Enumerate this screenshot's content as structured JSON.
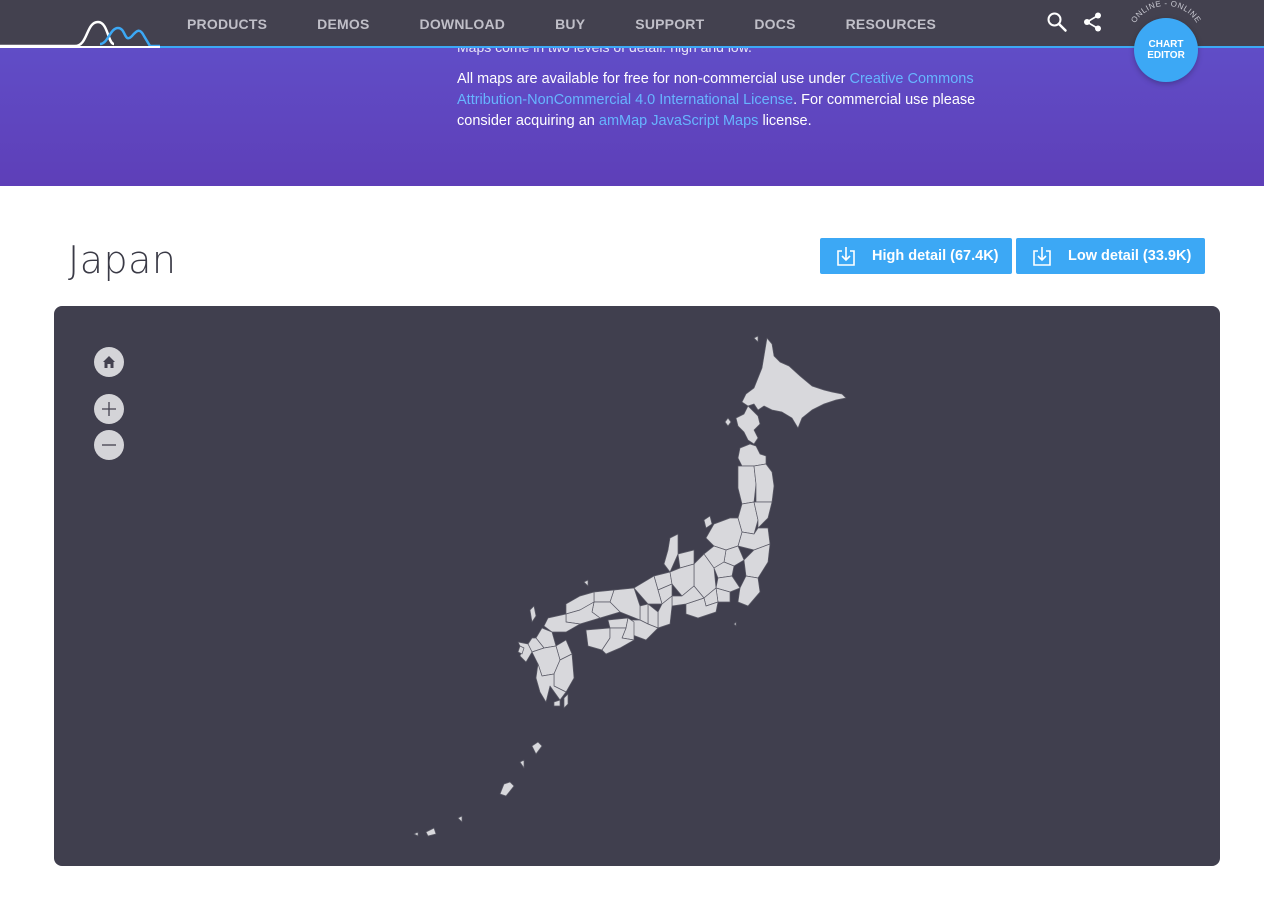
{
  "nav": {
    "items": [
      "PRODUCTS",
      "DEMOS",
      "DOWNLOAD",
      "BUY",
      "SUPPORT",
      "DOCS",
      "RESOURCES"
    ],
    "search_icon": "search-icon",
    "share_icon": "share-icon",
    "editor_badge": {
      "arc_text": "ONLINE - ONLINE",
      "line1": "CHART",
      "line2": "EDITOR"
    }
  },
  "hero": {
    "cut_text": "Maps come in two levels of detail: high and low.",
    "text_before": "All maps are available for free for non-commercial use under ",
    "license_link": "Creative Commons Attribution-NonCommercial 4.0 International License",
    "text_middle": ". For commercial use please consider acquiring an ",
    "ammap_link": "amMap JavaScript Maps",
    "text_after": " license."
  },
  "page": {
    "title": "Japan",
    "downloads": [
      {
        "label": "High detail (67.4K)"
      },
      {
        "label": "Low detail (33.9K)"
      }
    ]
  },
  "map": {
    "controls": [
      "home-icon",
      "zoom-in-icon",
      "zoom-out-icon"
    ],
    "land_color": "#d8d8dc",
    "border_color": "#5a5a66",
    "background": "#403f4e"
  },
  "colors": {
    "accent": "#3ca8f5",
    "hero": "#5e3fb8",
    "topbar": "#43414f"
  }
}
